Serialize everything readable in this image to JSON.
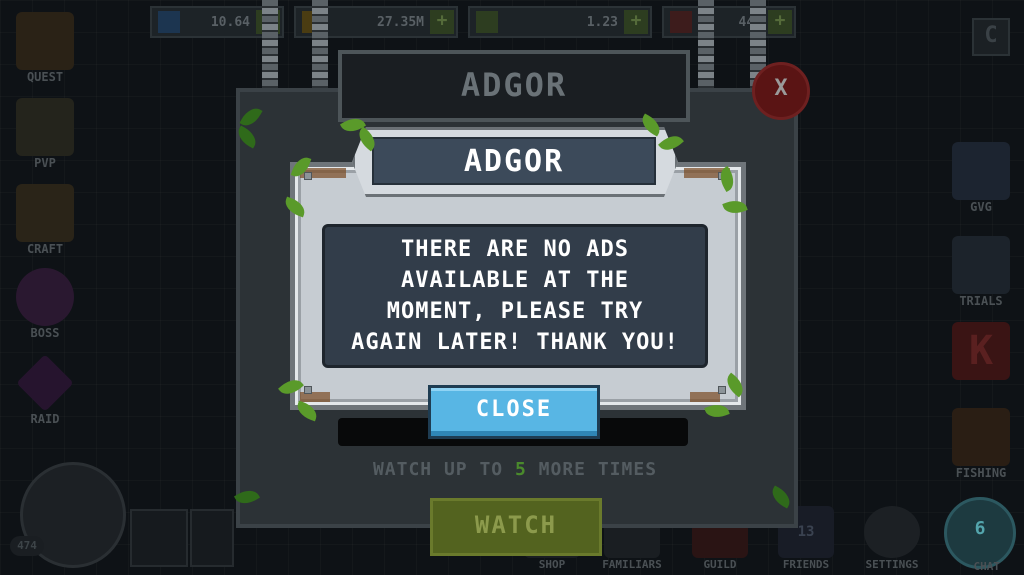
{
  "resources": [
    {
      "icon": "gem-icon",
      "value": "10.64",
      "color": "#2a5a8a"
    },
    {
      "icon": "coin-icon",
      "value": "27.35M",
      "color": "#8a7020"
    },
    {
      "icon": "ticket-icon",
      "value": "1.23",
      "color": "#4a6a30"
    },
    {
      "icon": "key-icon",
      "value": "440",
      "color": "#6a3030"
    }
  ],
  "left_menu": [
    "QUEST",
    "PVP",
    "CRAFT",
    "BOSS",
    "RAID"
  ],
  "right_menu": [
    "GVG",
    "TRIALS",
    "",
    "FISHING"
  ],
  "bottom_menu": [
    "SHOP",
    "FAMILIARS",
    "GUILD",
    "FRIENDS",
    "SETTINGS"
  ],
  "chat": {
    "label": "CHAT",
    "count": "6"
  },
  "level": "474",
  "friends_count": "13",
  "back_panel": {
    "title": "ADGOR",
    "watch_prefix": "WATCH UP TO ",
    "watch_count": "5",
    "watch_suffix": " MORE TIMES",
    "watch_button": "WATCH",
    "close_glyph": "X"
  },
  "dialog": {
    "title": "ADGOR",
    "message_lines": [
      "THERE ARE NO ADS",
      "AVAILABLE AT THE",
      "MOMENT, PLEASE TRY",
      "AGAIN LATER! THANK YOU!"
    ],
    "close_button": "CLOSE"
  },
  "colors": {
    "accent_blue": "#58b6e4",
    "watch_green": "#53631f",
    "highlight_green": "#4a8a2c"
  }
}
